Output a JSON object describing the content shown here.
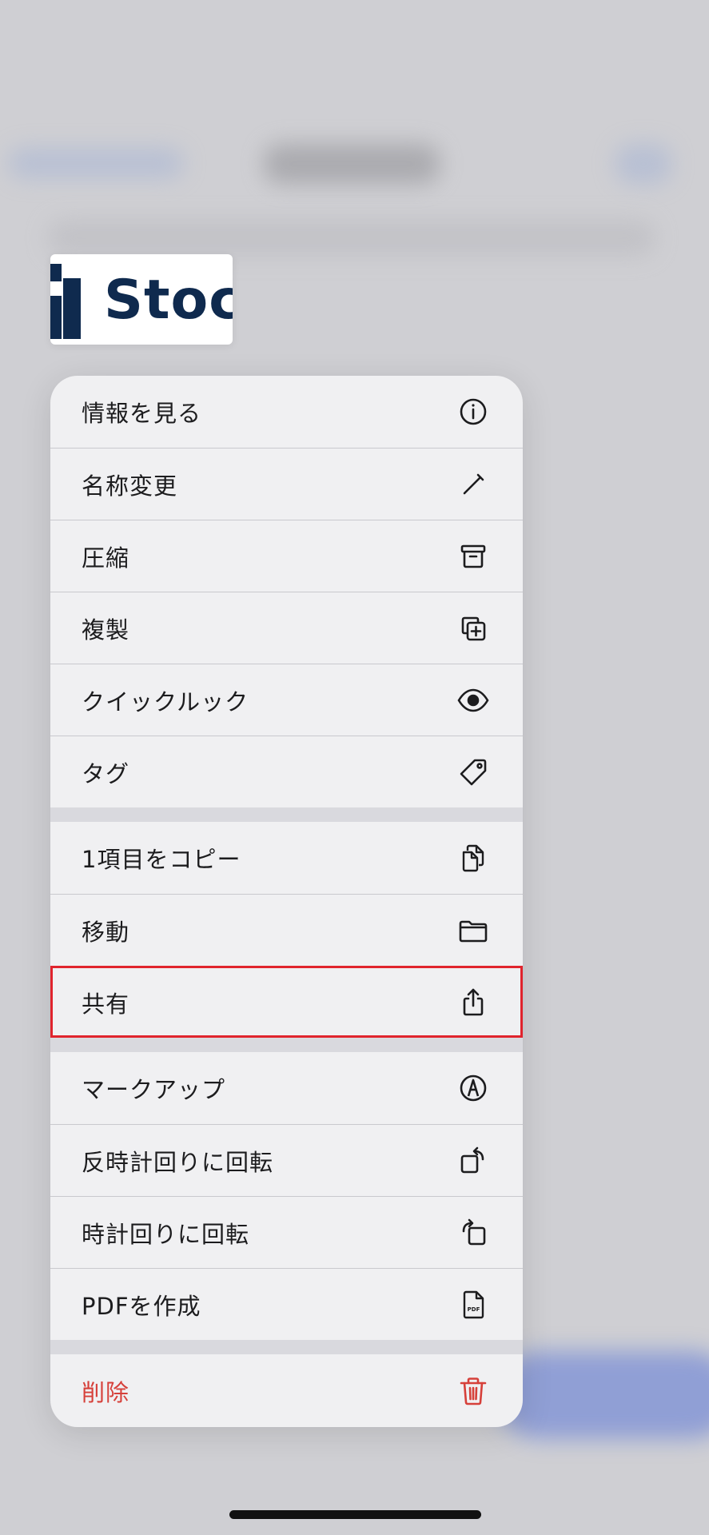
{
  "thumbnail": {
    "logo_text": "Stoc"
  },
  "menu": {
    "group1": [
      {
        "label": "情報を見る",
        "icon": "info-circle-icon"
      },
      {
        "label": "名称変更",
        "icon": "pencil-icon"
      },
      {
        "label": "圧縮",
        "icon": "archive-box-icon"
      },
      {
        "label": "複製",
        "icon": "duplicate-plus-icon"
      },
      {
        "label": "クイックルック",
        "icon": "eye-icon"
      },
      {
        "label": "タグ",
        "icon": "tag-icon"
      }
    ],
    "group2": [
      {
        "label": "1項目をコピー",
        "icon": "copy-documents-icon"
      },
      {
        "label": "移動",
        "icon": "folder-icon"
      },
      {
        "label": "共有",
        "icon": "share-icon"
      }
    ],
    "group3": [
      {
        "label": "マークアップ",
        "icon": "markup-pen-icon"
      },
      {
        "label": "反時計回りに回転",
        "icon": "rotate-left-icon"
      },
      {
        "label": "時計回りに回転",
        "icon": "rotate-right-icon"
      },
      {
        "label": "PDFを作成",
        "icon": "pdf-document-icon",
        "icon_text": "PDF"
      }
    ],
    "group4": [
      {
        "label": "削除",
        "icon": "trash-icon"
      }
    ]
  },
  "colors": {
    "destructive": "#d6403a",
    "highlight_outline": "#e0242d",
    "logo_navy": "#0f2a4e"
  }
}
